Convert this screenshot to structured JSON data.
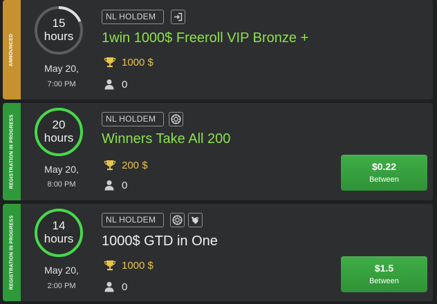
{
  "colors": {
    "background": "#1d1f21",
    "card": "#2c2e30",
    "announced": "#c6922f",
    "registration": "#2f9a3a",
    "ring_active": "#47d84a",
    "title_green": "#8ee14a",
    "prize_gold": "#e8c34a",
    "button_green": "#38a040"
  },
  "tournaments": [
    {
      "status": "ANNOUNCED",
      "countdown_number": "15",
      "countdown_unit": "hours",
      "countdown_progress": 0.3,
      "date": "May 20,",
      "time": "7:00 PM",
      "game": "NL HOLDEM",
      "badge_icons": [
        "enter-icon"
      ],
      "name": "1win 1000$ Freeroll VIP Bronze +",
      "prize": "1000 $",
      "players": "0"
    },
    {
      "status": "REGISTRATION IN PROGRESS",
      "countdown_number": "20",
      "countdown_unit": "hours",
      "countdown_progress": 1.0,
      "date": "May 20,",
      "time": "8:00 PM",
      "game": "NL HOLDEM",
      "badge_icons": [
        "chip-icon"
      ],
      "name": "Winners Take All 200",
      "prize": "200 $",
      "players": "0",
      "buyin_amount": "$0.22",
      "buyin_label": "Between"
    },
    {
      "status": "REGISTRATION IN PROGRESS",
      "countdown_number": "14",
      "countdown_unit": "hours",
      "countdown_progress": 1.0,
      "date": "May 20,",
      "time": "2:00 PM",
      "game": "NL HOLDEM",
      "badge_icons": [
        "chip-icon",
        "bounty-icon"
      ],
      "name": "1000$ GTD in One",
      "prize": "1000 $",
      "players": "0",
      "buyin_amount": "$1.5",
      "buyin_label": "Between"
    }
  ]
}
